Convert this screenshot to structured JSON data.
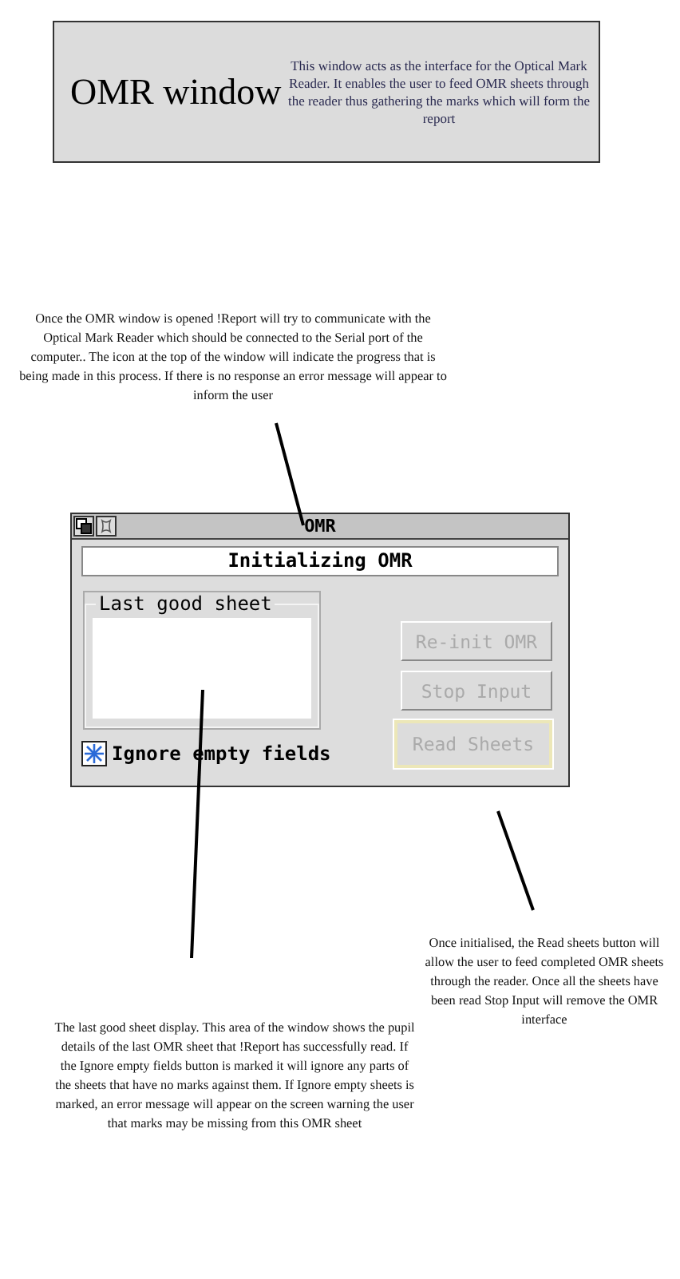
{
  "header": {
    "title": "OMR window",
    "description": "This window acts as the interface for the Optical Mark Reader. It enables the user to feed OMR sheets through the reader thus gathering the marks which will form the report"
  },
  "top_note": "Once the OMR window is opened !Report will try to communicate with the Optical Mark Reader which should be connected to the Serial port of the computer.. The icon at the top of the window will indicate the progress that is being made in this process. If there is no response an error message will appear to inform the user",
  "window": {
    "title": "OMR",
    "status": "Initializing OMR",
    "group_label": "Last good sheet",
    "checkbox": {
      "label": "Ignore empty fields",
      "checked": true
    },
    "buttons": [
      {
        "label": "Re-init OMR",
        "disabled": true,
        "default": false
      },
      {
        "label": "Stop Input",
        "disabled": true,
        "default": false
      },
      {
        "label": "Read Sheets",
        "disabled": true,
        "default": true
      }
    ]
  },
  "left_note": "The last good sheet display. This area of the window shows the pupil details of the last OMR sheet that !Report has successfully read. If the Ignore empty fields button is marked it will ignore any parts of the sheets that have no marks against them. If Ignore empty sheets is marked, an error message will appear on the screen warning the user that marks may be missing from this OMR sheet",
  "right_note": "Once initialised, the Read sheets button will allow the user to feed completed OMR sheets through the reader. Once all the sheets have been read Stop Input will remove the OMR interface"
}
